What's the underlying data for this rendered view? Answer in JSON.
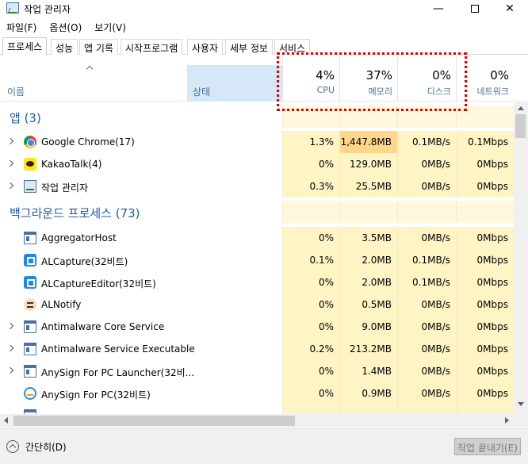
{
  "window": {
    "title": "작업 관리자"
  },
  "menu": [
    "파일(F)",
    "옵션(O)",
    "보기(V)"
  ],
  "tabs": [
    "프로세스",
    "성능",
    "앱 기록",
    "시작프로그램",
    "사용자",
    "세부 정보",
    "서비스"
  ],
  "headers": {
    "name": "이름",
    "status": "상태",
    "cpu": {
      "pct": "4%",
      "label": "CPU"
    },
    "memory": {
      "pct": "37%",
      "label": "메모리"
    },
    "disk": {
      "pct": "0%",
      "label": "디스크"
    },
    "network": {
      "pct": "0%",
      "label": "네트워크"
    }
  },
  "groups": {
    "apps": "앱 (3)",
    "background": "백그라운드 프로세스 (73)"
  },
  "apps": [
    {
      "name": "Google Chrome(17)",
      "icon": "chrome-icon",
      "cpu": "1.3%",
      "mem": "1,447.8MB",
      "disk": "0.1MB/s",
      "net": "0.1Mbps"
    },
    {
      "name": "KakaoTalk(4)",
      "icon": "kakaotalk-icon",
      "cpu": "0%",
      "mem": "129.0MB",
      "disk": "0MB/s",
      "net": "0Mbps"
    },
    {
      "name": "작업 관리자",
      "icon": "task-manager-icon",
      "cpu": "0.3%",
      "mem": "25.5MB",
      "disk": "0MB/s",
      "net": "0Mbps"
    }
  ],
  "background": [
    {
      "name": "AggregatorHost",
      "icon": "window-icon",
      "cpu": "0%",
      "mem": "3.5MB",
      "disk": "0MB/s",
      "net": "0Mbps"
    },
    {
      "name": "ALCapture(32비트)",
      "icon": "capture-icon",
      "cpu": "0.1%",
      "mem": "2.0MB",
      "disk": "0.1MB/s",
      "net": "0Mbps"
    },
    {
      "name": "ALCaptureEditor(32비트)",
      "icon": "capture-icon",
      "cpu": "0%",
      "mem": "2.0MB",
      "disk": "0.1MB/s",
      "net": "0Mbps"
    },
    {
      "name": "ALNotify",
      "icon": "notify-icon",
      "cpu": "0%",
      "mem": "0.5MB",
      "disk": "0MB/s",
      "net": "0Mbps"
    },
    {
      "name": "Antimalware Core Service",
      "icon": "window-icon",
      "cpu": "0%",
      "mem": "9.0MB",
      "disk": "0MB/s",
      "net": "0Mbps"
    },
    {
      "name": "Antimalware Service Executable",
      "icon": "window-icon",
      "cpu": "0.2%",
      "mem": "213.2MB",
      "disk": "0MB/s",
      "net": "0Mbps"
    },
    {
      "name": "AnySign For PC Launcher(32비...",
      "icon": "window-icon",
      "cpu": "0%",
      "mem": "1.4MB",
      "disk": "0MB/s",
      "net": "0Mbps"
    },
    {
      "name": "AnySign For PC(32비트)",
      "icon": "anysign-icon",
      "cpu": "0%",
      "mem": "0.9MB",
      "disk": "0MB/s",
      "net": "0Mbps"
    }
  ],
  "footer": {
    "fewer_details": "간단히(D)",
    "end_task": "작업 끝내기(E)"
  }
}
